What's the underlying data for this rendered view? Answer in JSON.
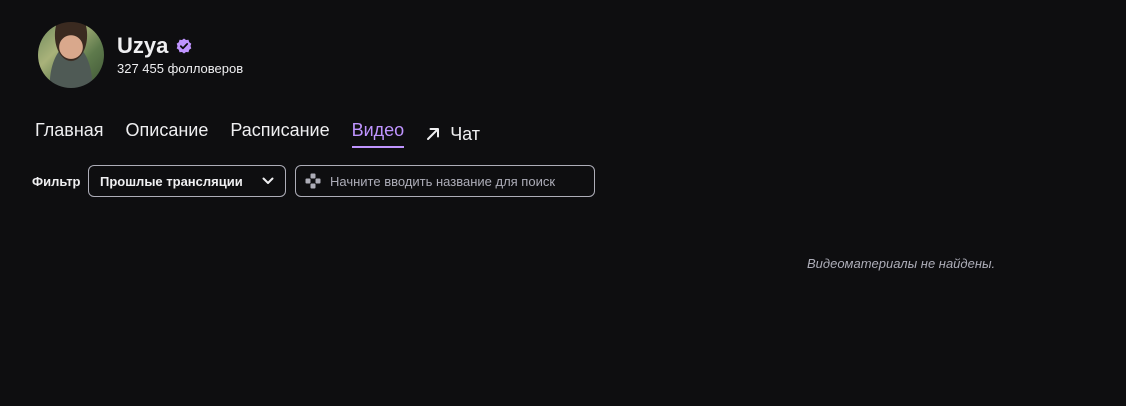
{
  "channel": {
    "name": "Uzya",
    "followers": "327 455 фолловеров",
    "verified_icon": "verified-badge-icon",
    "accent_color": "#bf94ff"
  },
  "tabs": [
    {
      "label": "Главная"
    },
    {
      "label": "Описание"
    },
    {
      "label": "Расписание"
    },
    {
      "label": "Видео",
      "active": true
    },
    {
      "label": "Чат",
      "icon": "external-arrow-icon"
    }
  ],
  "filter": {
    "label": "Фильтр",
    "selected": "Прошлые трансляции",
    "icon": "chevron-down-icon"
  },
  "search": {
    "placeholder": "Начните вводить название для поиск",
    "icon": "gamepad-icon"
  },
  "empty_message": "Видеоматериалы не найдены."
}
